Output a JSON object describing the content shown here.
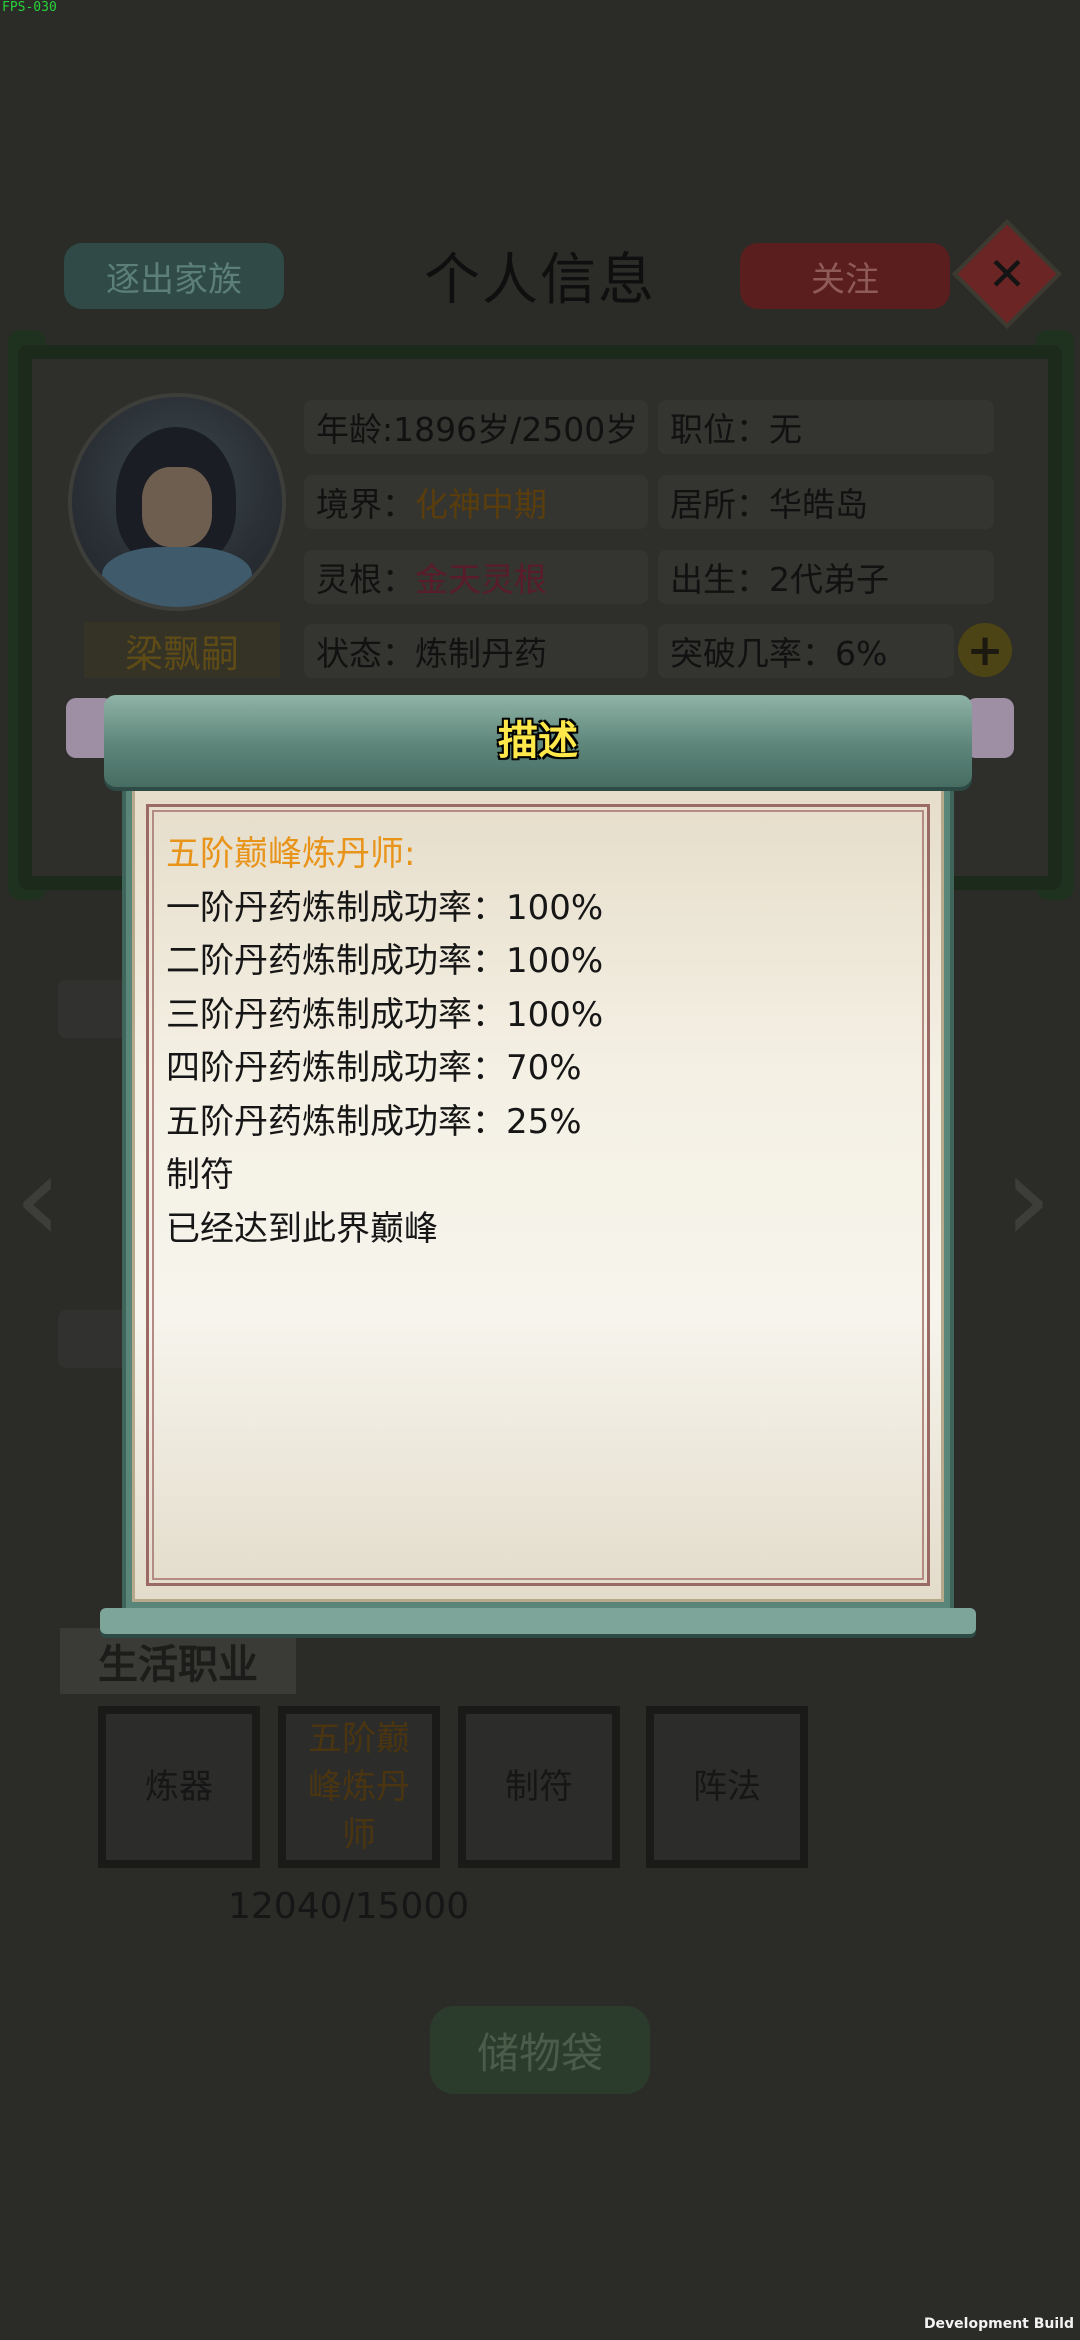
{
  "debug": {
    "fps": "FPS-030",
    "build": "Development Build"
  },
  "header": {
    "expel_label": "逐出家族",
    "title": "个人信息",
    "follow_label": "关注",
    "close_icon": "close-icon"
  },
  "profile": {
    "name": "梁飘嗣",
    "rows": [
      {
        "left": "年龄:1896岁/2500岁",
        "right": "职位：无"
      },
      {
        "left_label": "境界：",
        "left_value": "化神中期",
        "right": "居所：华皓岛"
      },
      {
        "left_label": "灵根：",
        "left_value": "金天灵根",
        "right": "出生：2代弟子"
      },
      {
        "left": "状态：炼制丹药",
        "right": "突破几率：6%"
      }
    ],
    "plus_icon": "plus-icon"
  },
  "life_jobs": {
    "title": "生活职业",
    "jobs": [
      "炼器",
      "五阶巅峰炼丹师",
      "制符",
      "阵法"
    ],
    "exp": "12040/15000"
  },
  "storage_label": "储物袋",
  "modal": {
    "title": "描述",
    "lines": [
      "五阶巅峰炼丹师:",
      "一阶丹药炼制成功率：100%",
      "二阶丹药炼制成功率：100%",
      "三阶丹药炼制成功率：100%",
      "四阶丹药炼制成功率：70%",
      "五阶丹药炼制成功率：25%",
      "制符",
      "已经达到此界巅峰"
    ]
  },
  "colors": {
    "modal_title": "#ffe84a",
    "desc_title": "#e8941a",
    "dim_overlay": "#2b2b28"
  }
}
